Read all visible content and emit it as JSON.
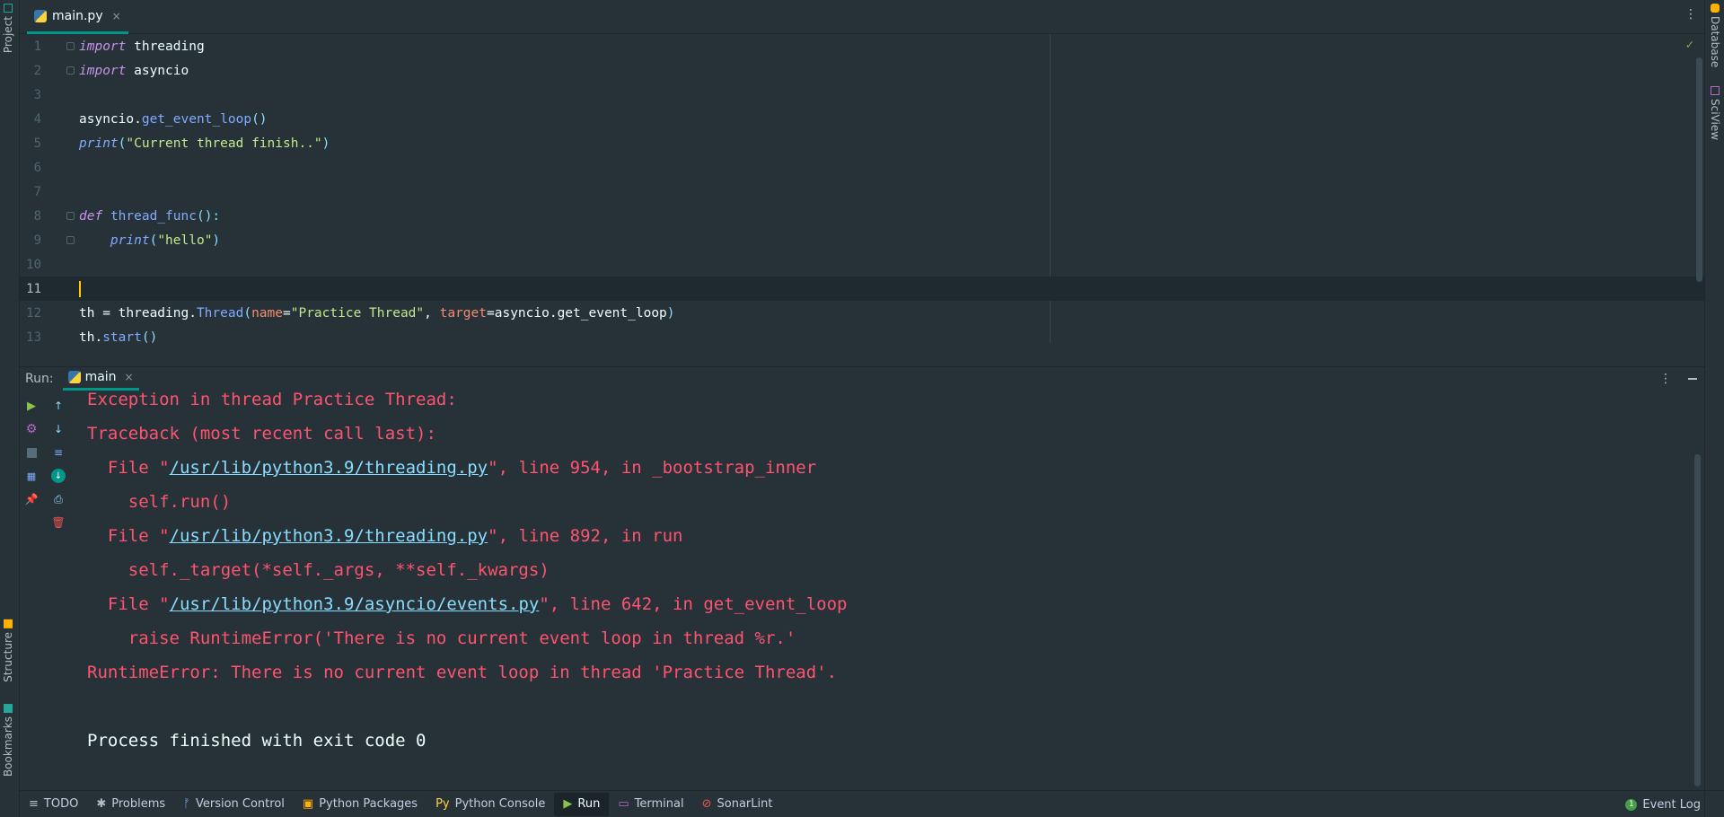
{
  "left_tool_strip": {
    "project": "Project",
    "structure": "Structure",
    "bookmarks": "Bookmarks"
  },
  "right_tool_strip": {
    "database": "Database",
    "sciview": "SciView"
  },
  "editor_tab": {
    "file_name": "main.py",
    "close": "×"
  },
  "editor": {
    "lines": [
      {
        "number": "1",
        "text": "import threading"
      },
      {
        "number": "2",
        "text": "import asyncio"
      },
      {
        "number": "3",
        "text": ""
      },
      {
        "number": "4",
        "text": "asyncio.get_event_loop()"
      },
      {
        "number": "5",
        "text": "print(\"Current thread finish..\")"
      },
      {
        "number": "6",
        "text": ""
      },
      {
        "number": "7",
        "text": ""
      },
      {
        "number": "8",
        "text": "def thread_func():"
      },
      {
        "number": "9",
        "text": "    print(\"hello\")"
      },
      {
        "number": "10",
        "text": ""
      },
      {
        "number": "11",
        "text": ""
      },
      {
        "number": "12",
        "text": "th = threading.Thread(name=\"Practice Thread\", target=asyncio.get_event_loop)"
      },
      {
        "number": "13",
        "text": "th.start()"
      }
    ],
    "current_line": "11"
  },
  "run_panel": {
    "label": "Run:",
    "tab_name": "main",
    "tab_close": "×"
  },
  "console": {
    "lines": [
      "Exception in thread Practice Thread:",
      "Traceback (most recent call last):",
      "  File \"/usr/lib/python3.9/threading.py\", line 954, in _bootstrap_inner",
      "    self.run()",
      "  File \"/usr/lib/python3.9/threading.py\", line 892, in run",
      "    self._target(*self._args, **self._kwargs)",
      "  File \"/usr/lib/python3.9/asyncio/events.py\", line 642, in get_event_loop",
      "    raise RuntimeError('There is no current event loop in thread %r.'",
      "RuntimeError: There is no current event loop in thread 'Practice Thread'.",
      "",
      "Process finished with exit code 0"
    ],
    "links": {
      "threading_path": "/usr/lib/python3.9/threading.py",
      "events_path": "/usr/lib/python3.9/asyncio/events.py"
    },
    "file_prefix": "  File \"",
    "frame1_suffix": "\", line 954, in _bootstrap_inner",
    "frame2_suffix": "\", line 892, in run",
    "frame3_suffix": "\", line 642, in get_event_loop"
  },
  "bottom_bar": {
    "items": [
      "TODO",
      "Problems",
      "Version Control",
      "Python Packages",
      "Python Console",
      "Run",
      "Terminal",
      "SonarLint"
    ],
    "active": "Run",
    "event_log": "Event Log",
    "event_count": "1"
  },
  "colors": {
    "background": "#263238",
    "error_text": "#ff5370",
    "link": "#89ddff",
    "accent": "#009688"
  }
}
